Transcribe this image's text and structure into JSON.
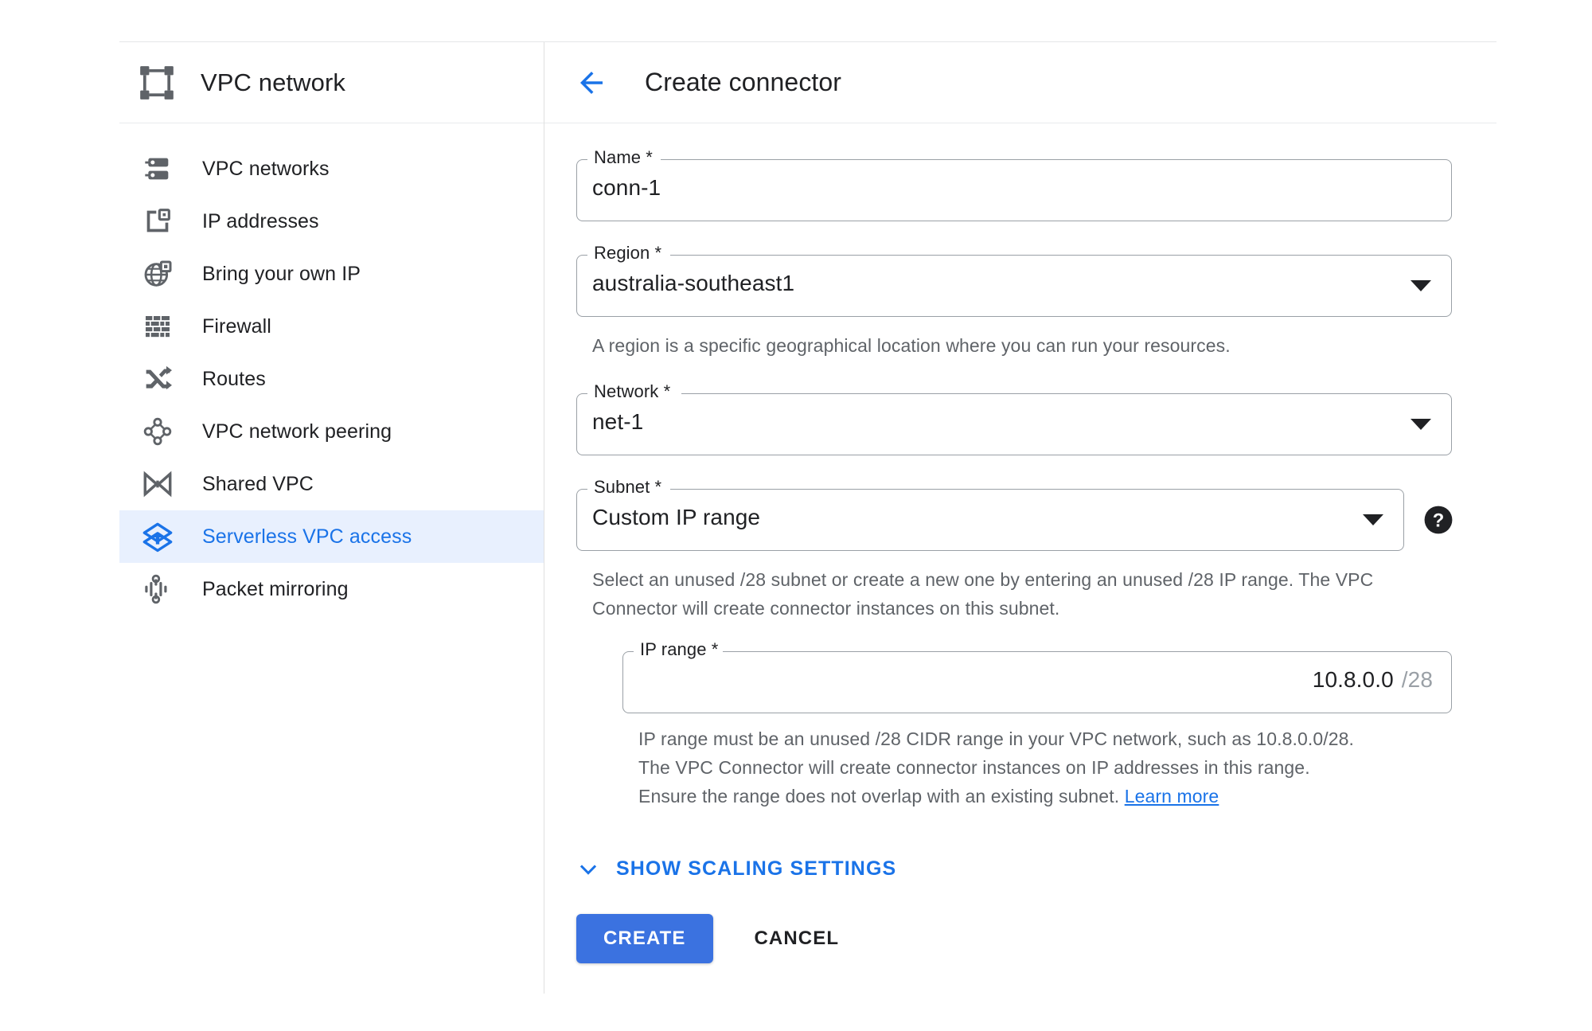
{
  "sidebar": {
    "product_title": "VPC network",
    "product_icon": "vpc-network-icon",
    "items": [
      {
        "label": "VPC networks",
        "icon": "server-rack-icon",
        "selected": false
      },
      {
        "label": "IP addresses",
        "icon": "ip-address-icon",
        "selected": false
      },
      {
        "label": "Bring your own IP",
        "icon": "globe-ip-icon",
        "selected": false
      },
      {
        "label": "Firewall",
        "icon": "brick-wall-icon",
        "selected": false
      },
      {
        "label": "Routes",
        "icon": "shuffle-arrows-icon",
        "selected": false
      },
      {
        "label": "VPC network peering",
        "icon": "peering-nodes-icon",
        "selected": false
      },
      {
        "label": "Shared VPC",
        "icon": "bowtie-icon",
        "selected": false
      },
      {
        "label": "Serverless VPC access",
        "icon": "layers-arrow-icon",
        "selected": true
      },
      {
        "label": "Packet mirroring",
        "icon": "packet-mirroring-icon",
        "selected": false
      }
    ]
  },
  "header": {
    "back_icon": "back-arrow-icon",
    "title": "Create connector"
  },
  "form": {
    "name": {
      "label": "Name *",
      "value": "conn-1"
    },
    "region": {
      "label": "Region *",
      "value": "australia-southeast1",
      "helper": "A region is a specific geographical location where you can run your resources.",
      "caret_icon": "chevron-down-icon"
    },
    "network": {
      "label": "Network *",
      "value": "net-1",
      "caret_icon": "chevron-down-icon"
    },
    "subnet": {
      "label": "Subnet *",
      "value": "Custom IP range",
      "helper": "Select an unused /28 subnet or create a new one by entering an unused /28 IP range. The VPC Connector will create connector instances on this subnet.",
      "caret_icon": "chevron-down-icon",
      "help_icon": "help-circle-icon"
    },
    "ip_range": {
      "label": "IP range *",
      "value": "10.8.0.0",
      "suffix": "/28",
      "helper_line1": "IP range must be an unused /28 CIDR range in your VPC network, such as 10.8.0.0/28.",
      "helper_line2": "The VPC Connector will create connector instances on IP addresses in this range.",
      "helper_line3": "Ensure the range does not overlap with an existing subnet.",
      "learn_more": "Learn more"
    }
  },
  "expander": {
    "label": "SHOW SCALING SETTINGS",
    "icon": "chevron-down-icon"
  },
  "actions": {
    "create_label": "CREATE",
    "cancel_label": "CANCEL"
  },
  "colors": {
    "accent_blue": "#1a73e8",
    "button_blue": "#3b72e0",
    "selected_bg": "#e8f0fe",
    "icon_gray": "#5f6368",
    "text_primary": "#202124",
    "text_secondary": "#5f6368",
    "outline_gray": "#9aa0a6"
  }
}
